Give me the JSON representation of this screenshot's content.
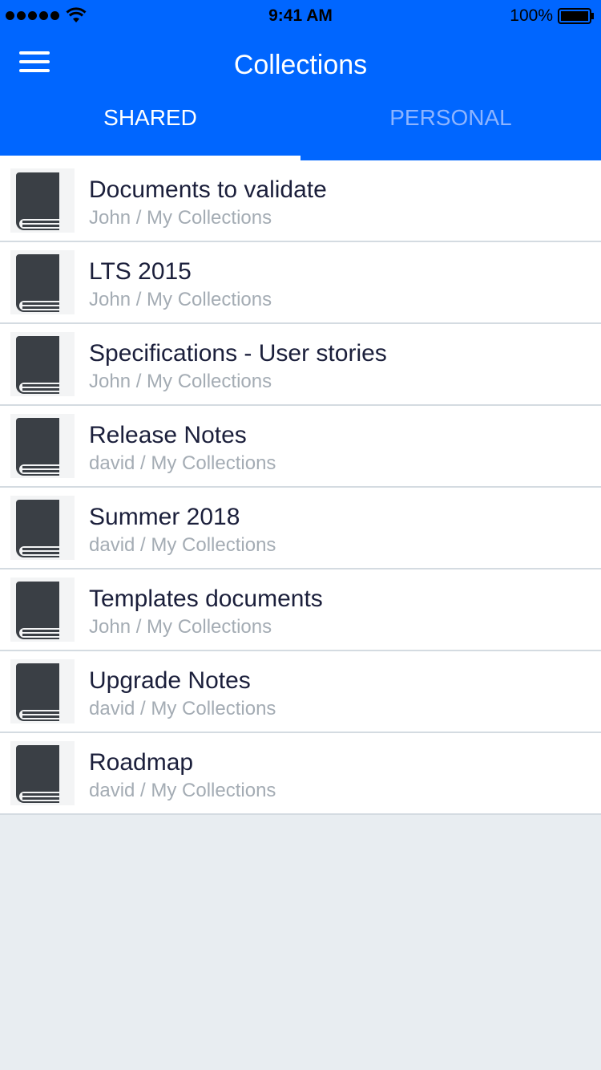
{
  "status_bar": {
    "time": "9:41 AM",
    "battery_percent": "100%"
  },
  "header": {
    "title": "Collections",
    "menu_icon": "hamburger-menu-icon"
  },
  "tabs": [
    {
      "label": "SHARED",
      "active": true
    },
    {
      "label": "PERSONAL",
      "active": false
    }
  ],
  "colors": {
    "header_bg": "#0066ff",
    "title_text": "#1b1f3b",
    "subtitle_text": "#a4acb4",
    "icon": "#3a3f45",
    "page_bg": "#e8edf1"
  },
  "collections": [
    {
      "title": "Documents to validate",
      "subtitle": "John / My Collections",
      "icon": "book-icon"
    },
    {
      "title": "LTS 2015",
      "subtitle": "John / My Collections",
      "icon": "book-icon"
    },
    {
      "title": "Specifications - User stories",
      "subtitle": "John / My Collections",
      "icon": "book-icon"
    },
    {
      "title": "Release Notes",
      "subtitle": "david / My Collections",
      "icon": "book-icon"
    },
    {
      "title": "Summer 2018",
      "subtitle": "david / My Collections",
      "icon": "book-icon"
    },
    {
      "title": "Templates documents",
      "subtitle": "John / My Collections",
      "icon": "book-icon"
    },
    {
      "title": "Upgrade Notes",
      "subtitle": "david / My Collections",
      "icon": "book-icon"
    },
    {
      "title": "Roadmap",
      "subtitle": "david / My Collections",
      "icon": "book-icon"
    }
  ]
}
